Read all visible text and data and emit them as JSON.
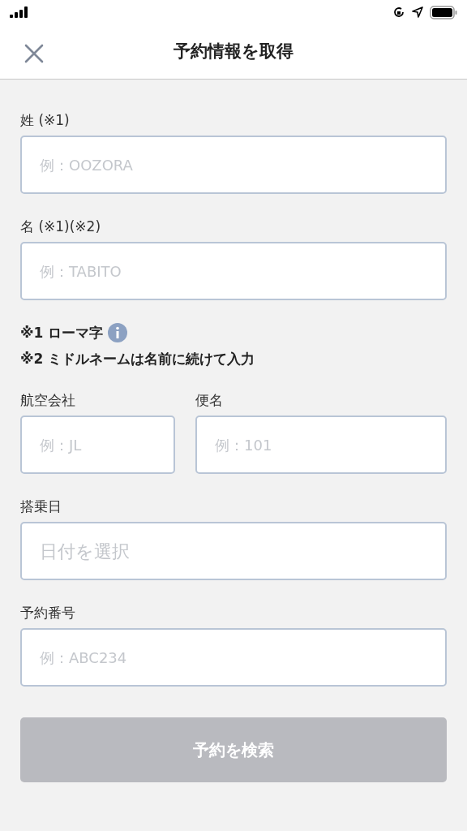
{
  "header": {
    "title": "予約情報を取得"
  },
  "rows": [
    {
      "fields": [
        {
          "label": "姓 (※1)",
          "placeholder": "例：OOZORA",
          "kind": "text"
        }
      ]
    },
    {
      "fields": [
        {
          "label": "名 (※1)(※2)",
          "placeholder": "例：TABITO",
          "kind": "text"
        }
      ]
    },
    {
      "notes": [
        {
          "text": "※1 ローマ字",
          "info": true
        },
        {
          "text": "※2 ミドルネームは名前に続けて入力",
          "info": false
        }
      ]
    },
    {
      "fields": [
        {
          "label": "航空会社",
          "placeholder": "例：JL",
          "kind": "text"
        },
        {
          "label": "便名",
          "placeholder": "例：101",
          "kind": "text"
        }
      ]
    },
    {
      "fields": [
        {
          "label": "搭乗日",
          "placeholder": "日付を選択",
          "kind": "date"
        }
      ]
    },
    {
      "fields": [
        {
          "label": "予約番号",
          "placeholder": "例：ABC234",
          "kind": "text"
        }
      ]
    }
  ],
  "submit": {
    "label": "予約を検索",
    "disabled": true
  }
}
